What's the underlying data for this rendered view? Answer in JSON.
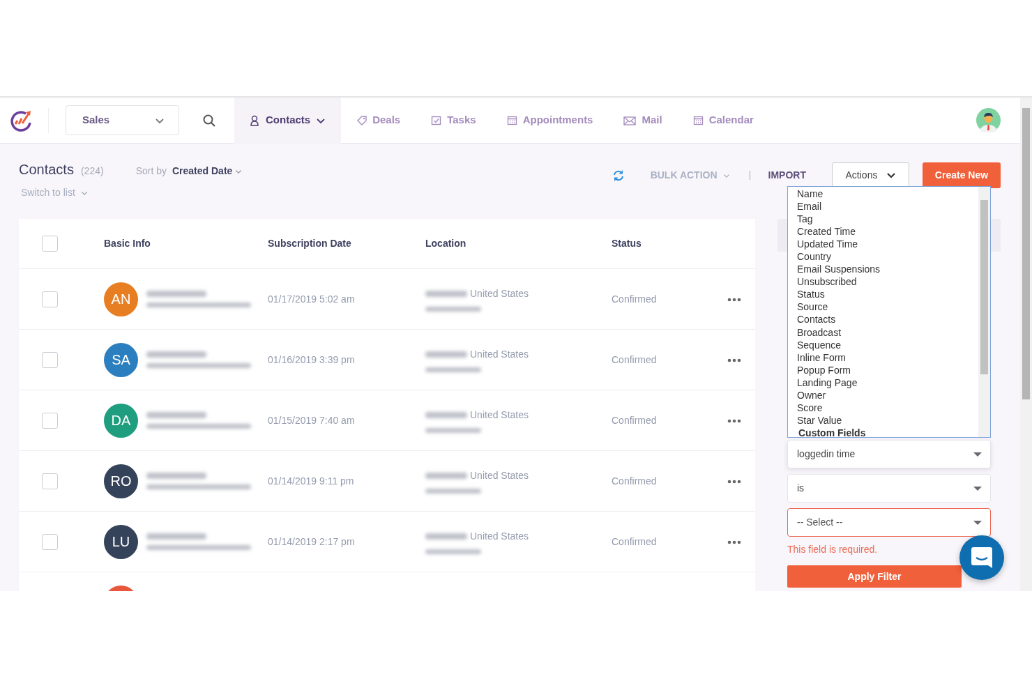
{
  "workspace": {
    "label": "Sales"
  },
  "nav": [
    {
      "label": "Contacts",
      "kind": "contacts",
      "selected": true
    },
    {
      "label": "Deals",
      "kind": "deals",
      "selected": false
    },
    {
      "label": "Tasks",
      "kind": "tasks",
      "selected": false
    },
    {
      "label": "Appointments",
      "kind": "appointments",
      "selected": false
    },
    {
      "label": "Mail",
      "kind": "mail",
      "selected": false
    },
    {
      "label": "Calendar",
      "kind": "calendar",
      "selected": false
    }
  ],
  "header": {
    "title": "Contacts",
    "count": "(224)",
    "sort_label": "Sort by",
    "sort_value": "Created Date",
    "switch": "Switch to list",
    "bulk_action": "BULK ACTION",
    "import": "IMPORT",
    "actions": "Actions",
    "create": "Create New"
  },
  "table": {
    "select_all": {
      "checked": false
    },
    "columns": [
      "Basic Info",
      "Subscription Date",
      "Location",
      "Status"
    ],
    "rows": [
      {
        "kind": "contact",
        "initials": "AN",
        "color": "#e87e22",
        "date": "01/17/2019 5:02 am",
        "location": "United States",
        "status": "Confirmed",
        "checked": false
      },
      {
        "kind": "contact",
        "initials": "SA",
        "color": "#2c7fbf",
        "date": "01/16/2019 3:39 pm",
        "location": "United States",
        "status": "Confirmed",
        "checked": false
      },
      {
        "kind": "contact",
        "initials": "DA",
        "color": "#1e9e7e",
        "date": "01/15/2019 7:40 am",
        "location": "United States",
        "status": "Confirmed",
        "checked": false
      },
      {
        "kind": "contact",
        "initials": "RO",
        "color": "#34435a",
        "date": "01/14/2019 9:11 pm",
        "location": "United States",
        "status": "Confirmed",
        "checked": false
      },
      {
        "kind": "contact",
        "initials": "LU",
        "color": "#34435a",
        "date": "01/14/2019 2:17 pm",
        "location": "United States",
        "status": "Confirmed",
        "checked": false
      },
      {
        "kind": "partial",
        "color": "#e8573c"
      }
    ]
  },
  "filter": {
    "options": [
      {
        "label": "Name",
        "kind": "option"
      },
      {
        "label": "Email",
        "kind": "option"
      },
      {
        "label": "Tag",
        "kind": "option"
      },
      {
        "label": "Created Time",
        "kind": "option"
      },
      {
        "label": "Updated Time",
        "kind": "option"
      },
      {
        "label": "Country",
        "kind": "option"
      },
      {
        "label": "Email Suspensions",
        "kind": "option"
      },
      {
        "label": "Unsubscribed",
        "kind": "option"
      },
      {
        "label": "Status",
        "kind": "option"
      },
      {
        "label": "Source",
        "kind": "option"
      },
      {
        "label": "Contacts",
        "kind": "option"
      },
      {
        "label": "Broadcast",
        "kind": "option"
      },
      {
        "label": "Sequence",
        "kind": "option"
      },
      {
        "label": "Inline Form",
        "kind": "option"
      },
      {
        "label": "Popup Form",
        "kind": "option"
      },
      {
        "label": "Landing Page",
        "kind": "option"
      },
      {
        "label": "Owner",
        "kind": "option"
      },
      {
        "label": "Score",
        "kind": "option"
      },
      {
        "label": "Star Value",
        "kind": "option"
      },
      {
        "label": "Custom Fields",
        "kind": "group"
      }
    ],
    "field": "loggedin time",
    "operator": "is",
    "value_placeholder": "-- Select --",
    "error": "This field is required.",
    "apply": "Apply Filter"
  }
}
